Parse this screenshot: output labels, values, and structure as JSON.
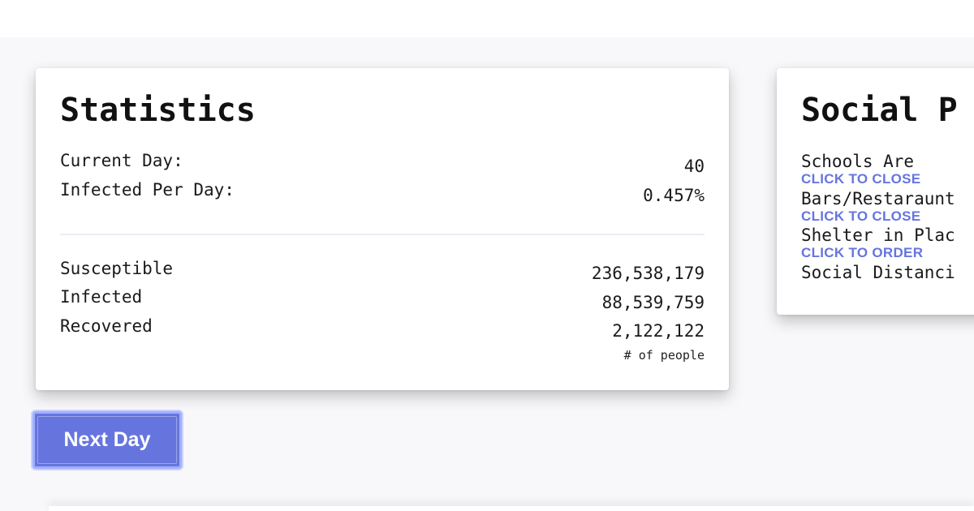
{
  "statistics": {
    "title": "Statistics",
    "current_day_label": "Current Day:",
    "current_day_value": "40",
    "infected_per_day_label": "Infected Per Day:",
    "infected_per_day_value": "0.457%",
    "susceptible_label": "Susceptible",
    "susceptible_value": "236,538,179",
    "infected_label": "Infected",
    "infected_value": "88,539,759",
    "recovered_label": "Recovered",
    "recovered_value": "2,122,122",
    "unit_note": "# of people"
  },
  "social_policy": {
    "title": "Social P",
    "items": [
      {
        "label": "Schools Are",
        "action": "CLICK TO CLOSE"
      },
      {
        "label": "Bars/Restaraunt",
        "action": "CLICK TO CLOSE"
      },
      {
        "label": "Shelter in Plac",
        "action": "CLICK TO ORDER"
      },
      {
        "label": "Social Distanci",
        "action": ""
      }
    ]
  },
  "controls": {
    "next_day_label": "Next Day"
  },
  "colors": {
    "accent": "#6675de",
    "page_background": "#f8f8fb",
    "card_background": "#ffffff"
  }
}
